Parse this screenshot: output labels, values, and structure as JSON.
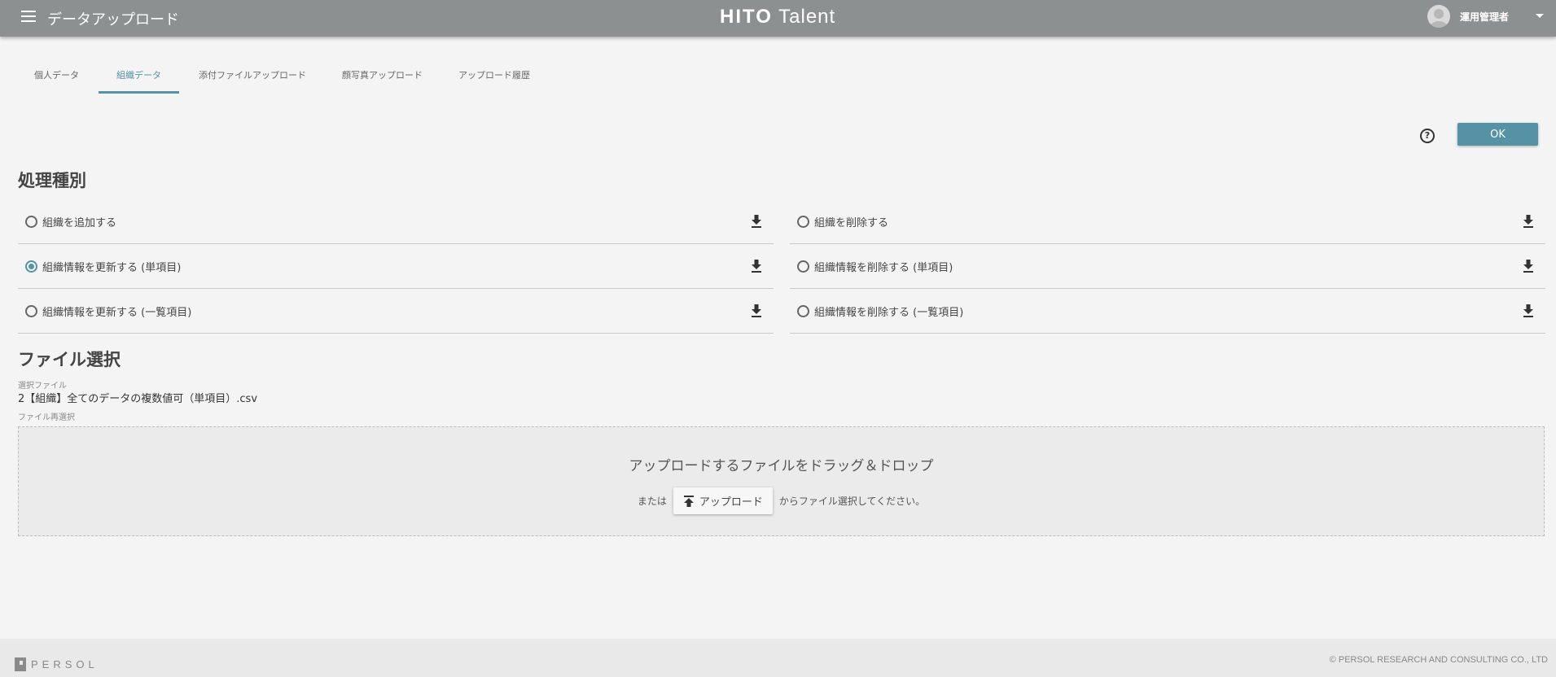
{
  "header": {
    "title": "データアップロード",
    "logo_bold": "HITO",
    "logo_light": "Talent",
    "user_name": "運用管理者"
  },
  "tabs": [
    {
      "label": "個人データ"
    },
    {
      "label": "組織データ",
      "active": true
    },
    {
      "label": "添付ファイルアップロード"
    },
    {
      "label": "顔写真アップロード"
    },
    {
      "label": "アップロード履歴"
    }
  ],
  "toolbar": {
    "help": "?",
    "ok_label": "OK"
  },
  "process": {
    "heading": "処理種別",
    "options": [
      {
        "label": "組織を追加する",
        "selected": false
      },
      {
        "label": "組織を削除する",
        "selected": false
      },
      {
        "label": "組織情報を更新する (単項目)",
        "selected": true
      },
      {
        "label": "組織情報を削除する (単項目)",
        "selected": false
      },
      {
        "label": "組織情報を更新する (一覧項目)",
        "selected": false
      },
      {
        "label": "組織情報を削除する (一覧項目)",
        "selected": false
      }
    ]
  },
  "file": {
    "heading": "ファイル選択",
    "selected_label": "選択ファイル",
    "selected_name": "2【組織】全てのデータの複数値可（単項目）.csv",
    "reselect_label": "ファイル再選択",
    "drop_text": "アップロードするファイルをドラッグ＆ドロップ",
    "or": "または",
    "upload_button": "アップロード",
    "suffix": "からファイル選択してください。"
  },
  "footer": {
    "brand": "PERSOL",
    "copyright": "© PERSOL RESEARCH AND CONSULTING CO., LTD"
  }
}
